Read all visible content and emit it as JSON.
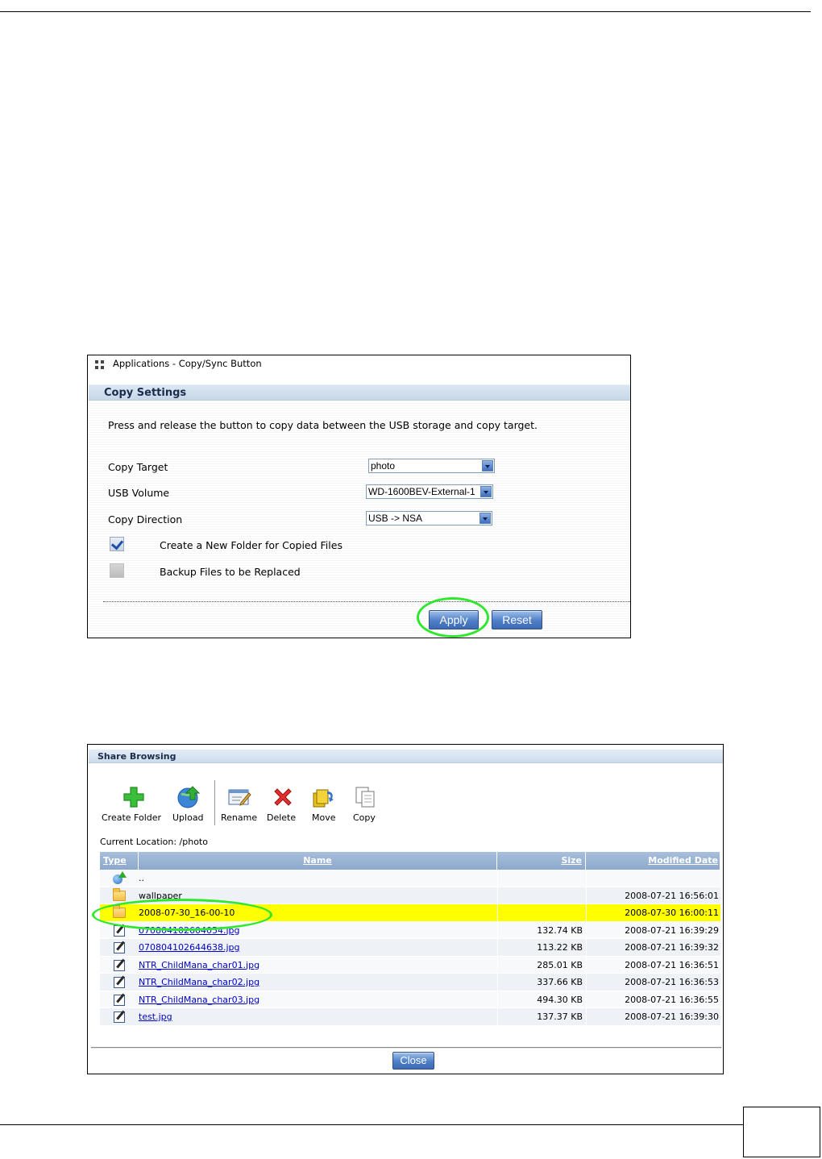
{
  "copy_panel": {
    "window_title": "Applications - Copy/Sync Button",
    "section_title": "Copy Settings",
    "description": "Press and release the button to copy data between the USB storage and copy target.",
    "fields": {
      "copy_target": {
        "label": "Copy Target",
        "value": "photo"
      },
      "usb_volume": {
        "label": "USB Volume",
        "value": "WD-1600BEV-External-1"
      },
      "copy_direction": {
        "label": "Copy Direction",
        "value": "USB -> NSA"
      }
    },
    "checkboxes": {
      "new_folder": {
        "label": "Create a New Folder for Copied Files",
        "checked": true
      },
      "backup_files": {
        "label": "Backup Files to be Replaced",
        "checked": false
      }
    },
    "buttons": {
      "apply": "Apply",
      "reset": "Reset"
    },
    "highlight_color": "#2ee82e"
  },
  "share_browsing": {
    "title": "Share Browsing",
    "toolbar": {
      "create_folder": "Create Folder",
      "upload": "Upload",
      "rename": "Rename",
      "delete": "Delete",
      "move": "Move",
      "copy": "Copy"
    },
    "current_location_label": "Current Location:",
    "current_location": "/photo",
    "columns": {
      "type": "Type",
      "name": "Name",
      "size": "Size",
      "modified": "Modified Date"
    },
    "rows": [
      {
        "type": "up",
        "name": "..",
        "size": "",
        "modified": ""
      },
      {
        "type": "folder",
        "name": "wallpaper",
        "size": "",
        "modified": "2008-07-21 16:56:01"
      },
      {
        "type": "folder",
        "name": "2008-07-30_16-00-10",
        "size": "",
        "modified": "2008-07-30 16:00:11",
        "highlighted": true
      },
      {
        "type": "file",
        "name": "070804102604054.jpg",
        "size": "132.74 KB",
        "modified": "2008-07-21 16:39:29"
      },
      {
        "type": "file",
        "name": "070804102644638.jpg",
        "size": "113.22 KB",
        "modified": "2008-07-21 16:39:32"
      },
      {
        "type": "file",
        "name": "NTR_ChildMana_char01.jpg",
        "size": "285.01 KB",
        "modified": "2008-07-21 16:36:51"
      },
      {
        "type": "file",
        "name": "NTR_ChildMana_char02.jpg",
        "size": "337.66 KB",
        "modified": "2008-07-21 16:36:53"
      },
      {
        "type": "file",
        "name": "NTR_ChildMana_char03.jpg",
        "size": "494.30 KB",
        "modified": "2008-07-21 16:36:55"
      },
      {
        "type": "file",
        "name": "test.jpg",
        "size": "137.37 KB",
        "modified": "2008-07-21 16:39:30"
      }
    ],
    "close_button": "Close",
    "highlight_row_color": "#ffff00"
  }
}
